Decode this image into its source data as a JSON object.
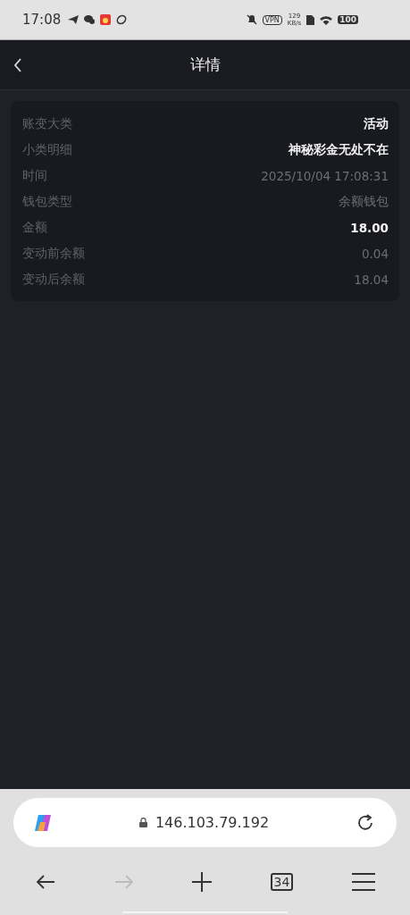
{
  "status_bar": {
    "time": "17:08",
    "vpn": "VPN",
    "speed_value": "129",
    "speed_unit": "KB/s",
    "battery": "100"
  },
  "header": {
    "title": "详情"
  },
  "details": [
    {
      "label": "账变大类",
      "value": "活动",
      "emphasis": true
    },
    {
      "label": "小类明细",
      "value": "神秘彩金无处不在",
      "emphasis": true
    },
    {
      "label": "时间",
      "value": "2025/10/04 17:08:31",
      "emphasis": false
    },
    {
      "label": "钱包类型",
      "value": "余额钱包",
      "emphasis": false
    },
    {
      "label": "金额",
      "value": "18.00",
      "emphasis": true
    },
    {
      "label": "变动前余额",
      "value": "0.04",
      "emphasis": false
    },
    {
      "label": "变动后余额",
      "value": "18.04",
      "emphasis": false
    }
  ],
  "browser": {
    "address": "146.103.79.192",
    "tab_count": "34",
    "forward_disabled": true
  }
}
